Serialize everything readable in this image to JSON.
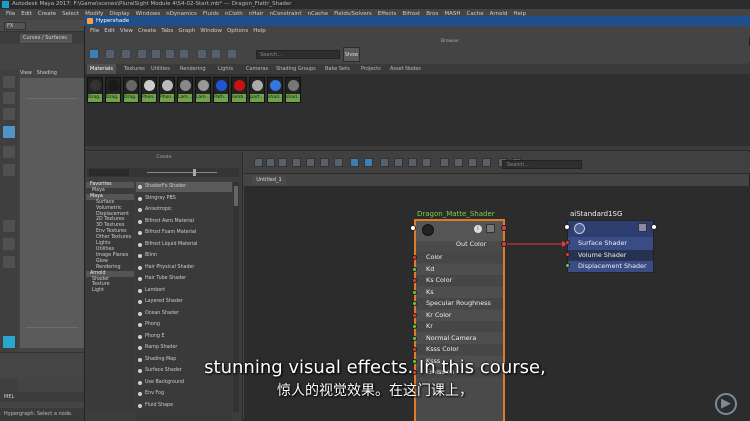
{
  "app": {
    "title": "Autodesk Maya 2017: F:\\Game\\scenes\\PluralSight Module 4\\S4-02-Start.mb* --- Dragon_Flattr_Shader",
    "menu": [
      "File",
      "Edit",
      "Create",
      "Select",
      "Modify",
      "Display",
      "Windows",
      "nDynamics",
      "Fluids",
      "nCloth",
      "nHair",
      "nConstraint",
      "nCache",
      "Fields/Solvers",
      "Effects",
      "Bifrost",
      "Bros",
      "MASH",
      "Cache",
      "Arnold",
      "Help"
    ]
  },
  "left": {
    "mode": "FX",
    "shelf_tab": "Curves / Surfaces",
    "viewport_menu": [
      "View",
      "Shading"
    ],
    "command_label": "MEL",
    "help_line": "Hypergraph: Select a node."
  },
  "hypershade": {
    "title": "Hypershade",
    "menu": [
      "File",
      "Edit",
      "View",
      "Create",
      "Tabs",
      "Graph",
      "Window",
      "Options",
      "Help"
    ],
    "browser_label": "Browser",
    "search_placeholder": "Search...",
    "show_button": "Show",
    "browser_tabs": [
      "Materials",
      "Textures",
      "Utilities",
      "Rendering",
      "Lights",
      "Cameras",
      "Shading Groups",
      "Bake Sets",
      "Projects",
      "Asset Nodes"
    ],
    "swatches": [
      {
        "label": "Drag...",
        "color": "#333333"
      },
      {
        "label": "Drag...",
        "color": "#1a1a1a"
      },
      {
        "label": "Drag...",
        "color": "#666666"
      },
      {
        "label": "Phon...",
        "color": "#cccccc"
      },
      {
        "label": "Phon...",
        "color": "#bbbbbb"
      },
      {
        "label": "Lam...",
        "color": "#888888"
      },
      {
        "label": "Lam...",
        "color": "#999999"
      },
      {
        "label": "Path...",
        "color": "#2255cc"
      },
      {
        "label": "lamb...",
        "color": "#cc1111"
      },
      {
        "label": "part...",
        "color": "#aaaaaa"
      },
      {
        "label": "shad...",
        "color": "#3377dd"
      },
      {
        "label": "shad...",
        "color": "#777777"
      }
    ],
    "create_title": "Create",
    "categories": [
      {
        "label": "Favorites",
        "type": "hdr"
      },
      {
        "label": "Maya",
        "type": "sub"
      },
      {
        "label": "Maya",
        "type": "hdr"
      },
      {
        "label": "Surface",
        "type": "item"
      },
      {
        "label": "Volumetric",
        "type": "item"
      },
      {
        "label": "Displacement",
        "type": "item"
      },
      {
        "label": "2D Textures",
        "type": "item"
      },
      {
        "label": "3D Textures",
        "type": "item"
      },
      {
        "label": "Env Textures",
        "type": "item"
      },
      {
        "label": "Other Textures",
        "type": "item"
      },
      {
        "label": "Lights",
        "type": "item"
      },
      {
        "label": "Utilities",
        "type": "item"
      },
      {
        "label": "Image Planes",
        "type": "item"
      },
      {
        "label": "Glow",
        "type": "item"
      },
      {
        "label": "Rendering",
        "type": "item"
      },
      {
        "label": "Arnold",
        "type": "hdr"
      },
      {
        "label": "Shader",
        "type": "sub"
      },
      {
        "label": "Texture",
        "type": "sub"
      },
      {
        "label": "Light",
        "type": "sub"
      }
    ],
    "create_nodes": [
      "ShaderFx Shader",
      "Stingray PBS",
      "Anisotropic",
      "Bifrost Aero Material",
      "Bifrost Foam Material",
      "Bifrost Liquid Material",
      "Blinn",
      "Hair Physical Shader",
      "Hair Tube Shader",
      "Lambert",
      "Layered Shader",
      "Ocean Shader",
      "Phong",
      "Phong E",
      "Ramp Shader",
      "Shading Map",
      "Surface Shader",
      "Use Background",
      "Env Fog",
      "Fluid Shape"
    ],
    "work_search_placeholder": "Search...",
    "work_tab": "Untitled_1"
  },
  "graph": {
    "node1": {
      "title": "Dragon_Matte_Shader",
      "out_label": "Out Color",
      "attrs": [
        "Color",
        "Kd",
        "Ks Color",
        "Ks",
        "Specular Roughness",
        "Kr Color",
        "Kr",
        "Normal Camera",
        "Ksss Color",
        "Ksss",
        "Emission"
      ]
    },
    "node2": {
      "title": "aiStandard1SG",
      "attrs": [
        "Surface Shader",
        "Volume Shader",
        "Displacement Shader"
      ]
    }
  },
  "subtitles": {
    "en": "stunning visual effects. In this course,",
    "zh": "惊人的视觉效果。在这门课上，"
  },
  "colors": {
    "node_orange": "#e07b28",
    "node_blue": "#3a4c86",
    "port_red": "#e23a3a",
    "port_green": "#66cc44",
    "title_bar": "#1f4f8a"
  }
}
